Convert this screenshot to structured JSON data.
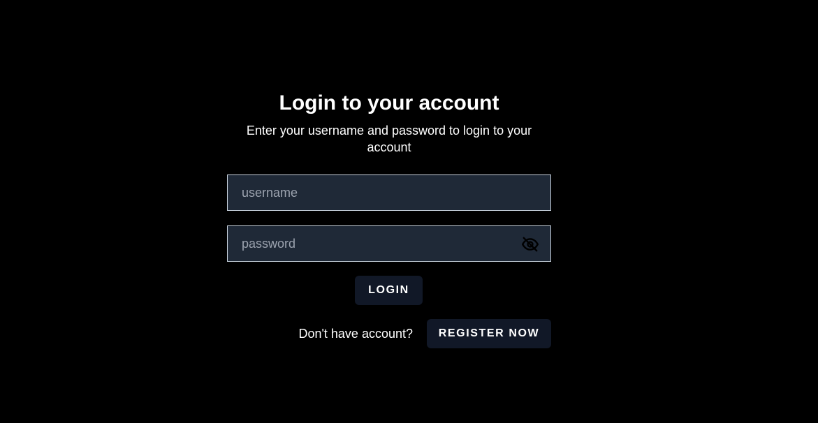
{
  "login": {
    "title": "Login to your account",
    "subtitle": "Enter your username and password to login to your account",
    "username": {
      "value": "",
      "placeholder": "username"
    },
    "password": {
      "value": "",
      "placeholder": "password",
      "visibility_icon": "eye-slash-icon"
    },
    "login_button": "LOGIN",
    "register_prompt": "Don't have account?",
    "register_button": "REGISTER NOW"
  },
  "colors": {
    "background": "#000000",
    "input_background": "#1f2937",
    "input_border": "#cbd5e1",
    "button_background": "#111827",
    "text": "#ffffff",
    "placeholder": "#9ca3af"
  }
}
